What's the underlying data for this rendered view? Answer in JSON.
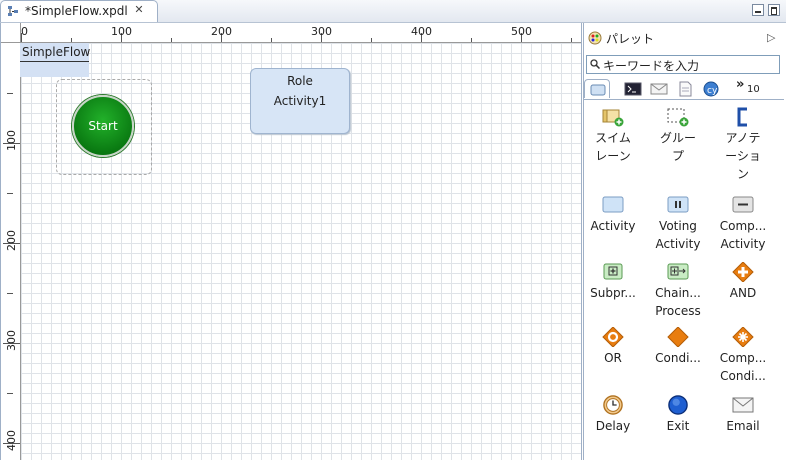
{
  "tab": {
    "title": "*SimpleFlow.xpdl",
    "close_icon": "close-icon"
  },
  "ruler": {
    "horizontal": [
      "0",
      "100",
      "200",
      "300",
      "400",
      "500"
    ],
    "vertical": [
      "100",
      "200",
      "300",
      "400"
    ]
  },
  "diagram": {
    "lane_label": "SimpleFlow",
    "start_label": "Start",
    "activity": {
      "role": "Role",
      "name": "Activity1"
    }
  },
  "palette": {
    "title": "パレット",
    "search_placeholder": "キーワードを入力",
    "more_tabs_count": "10",
    "items": [
      {
        "label": "スイム\nレーン",
        "icon": "swimlane-icon"
      },
      {
        "label": "グルー\nプ",
        "icon": "group-icon"
      },
      {
        "label": "アノテ\nーショ\nン",
        "icon": "annotation-icon"
      },
      {
        "label": "Activity",
        "icon": "activity-icon"
      },
      {
        "label": "Voting\nActivity",
        "icon": "voting-activity-icon"
      },
      {
        "label": "Comp...\nActivity",
        "icon": "compensation-activity-icon"
      },
      {
        "label": "Subpr...",
        "icon": "subprocess-icon"
      },
      {
        "label": "Chain...\nProcess",
        "icon": "chained-process-icon"
      },
      {
        "label": "AND",
        "icon": "and-gateway-icon"
      },
      {
        "label": "OR",
        "icon": "or-gateway-icon"
      },
      {
        "label": "Condi...",
        "icon": "conditional-gateway-icon"
      },
      {
        "label": "Comp...\nCondi...",
        "icon": "complex-conditional-icon"
      },
      {
        "label": "Delay",
        "icon": "delay-icon"
      },
      {
        "label": "Exit",
        "icon": "exit-icon"
      },
      {
        "label": "Email",
        "icon": "email-icon"
      }
    ]
  },
  "colors": {
    "start": "#0f8a16",
    "activity_fill": "#d7e5f6",
    "gateway": "#e87d10"
  }
}
